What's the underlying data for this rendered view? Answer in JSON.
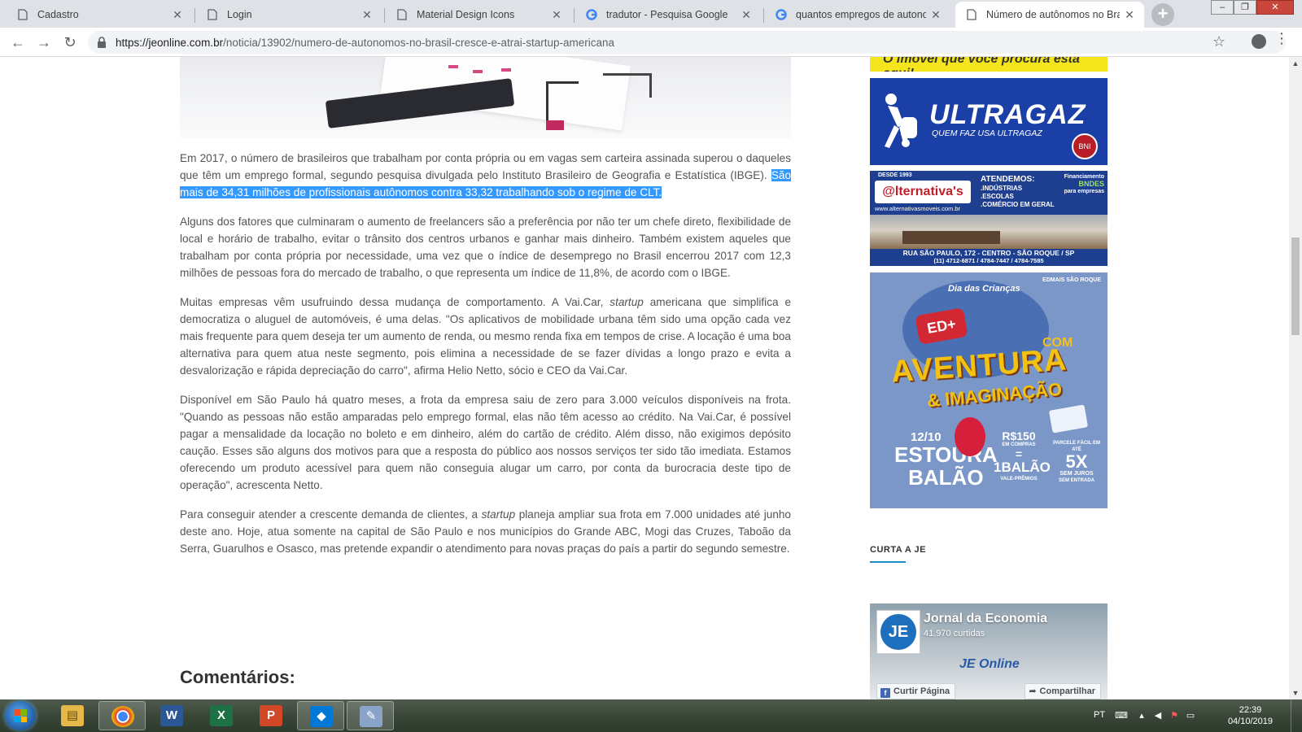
{
  "browser": {
    "tabs": [
      {
        "title": "Cadastro",
        "icon": "page-icon",
        "active": false
      },
      {
        "title": "Login",
        "icon": "page-icon",
        "active": false
      },
      {
        "title": "Material Design Icons",
        "icon": "page-icon",
        "active": false
      },
      {
        "title": "tradutor - Pesquisa Google",
        "icon": "google-icon",
        "active": false
      },
      {
        "title": "quantos empregos de autonom",
        "icon": "google-icon",
        "active": false
      },
      {
        "title": "Número de autônomos no Bras",
        "icon": "page-icon",
        "active": true
      }
    ],
    "close_glyph": "✕",
    "url_host": "https://jeonline.com.br",
    "url_path": "/noticia/13902/numero-de-autonomos-no-brasil-cresce-e-atrai-startup-americana"
  },
  "article": {
    "p1_before": "Em 2017, o número de brasileiros que trabalham por conta própria ou em vagas sem carteira assinada superou o daqueles que têm um emprego formal, segundo pesquisa divulgada pelo Instituto Brasileiro de Geografia e Estatística (IBGE). ",
    "p1_highlight": "São mais de 34,31 milhões de profissionais autônomos contra 33,32 trabalhando sob o regime de CLT.",
    "p2": "Alguns dos fatores que culminaram o aumento de freelancers são a preferência por não ter um chefe direto, flexibilidade de local e horário de trabalho, evitar o trânsito dos centros urbanos e ganhar mais dinheiro. Também existem aqueles que trabalham por conta própria por necessidade, uma vez que o índice de desemprego no Brasil encerrou 2017 com 12,3 milhões de pessoas fora do mercado de trabalho, o que representa um índice de 11,8%, de acordo com o IBGE.",
    "p3_a": "Muitas empresas vêm usufruindo dessa mudança de comportamento. A Vai.Car, ",
    "p3_em": "startup",
    "p3_b": " americana que simplifica e democratiza o aluguel de automóveis, é uma delas. \"Os aplicativos de mobilidade urbana têm sido uma opção cada vez mais frequente para quem deseja ter um aumento de renda, ou mesmo renda fixa em tempos de crise. A locação é uma boa alternativa para quem atua neste segmento, pois elimina a necessidade de se fazer dívidas a longo prazo e evita a desvalorização e rápida depreciação do carro\", afirma Helio Netto, sócio e CEO da Vai.Car.",
    "p4": "Disponível em São Paulo há quatro meses, a frota da empresa saiu de zero para 3.000 veículos disponíveis na frota. \"Quando as pessoas não estão amparadas pelo emprego formal, elas não têm acesso ao crédito. Na Vai.Car, é possível pagar a mensalidade da locação no boleto e em dinheiro, além do cartão de crédito. Além disso, não exigimos depósito caução. Esses são alguns dos motivos para que a resposta do público aos nossos serviços ter sido tão imediata. Estamos oferecendo um produto acessível para quem não conseguia alugar um carro, por conta da burocracia deste tipo de operação\", acrescenta Netto.",
    "p5_a": "Para conseguir atender a crescente demanda de clientes, a ",
    "p5_em": "startup",
    "p5_b": " planeja ampliar sua frota em 7.000 unidades até junho deste ano. Hoje, atua somente na capital de São Paulo e nos municípios do Grande ABC, Mogi das Cruzes, Taboão da Serra, Guarulhos e Osasco, mas pretende expandir o atendimento para novas praças do país a partir do segundo semestre.",
    "comments_title": "Comentários:"
  },
  "sidebar": {
    "ad_yellow_text": "O imóvel que você procura está aqui!",
    "ultragaz": {
      "logo": "ULTRAGAZ",
      "tagline": "QUEM FAZ USA ULTRAGAZ",
      "badge": "BNI"
    },
    "alternativas": {
      "since": "DESDE 1993",
      "brand": "@lternativa's",
      "site": "www.alternativasmoveis.com.br",
      "atend_title": "ATENDEMOS:",
      "atend_1": ".INDÚSTRIAS",
      "atend_2": ".ESCOLAS",
      "atend_3": ".COMÉRCIO EM GERAL",
      "fin_1": "Financiamento",
      "fin_2": "BNDES",
      "fin_3": "para empresas",
      "address": "RUA SÃO PAULO, 172 - CENTRO - SÃO ROQUE / SP",
      "phones": "(11) 4712-6871 / 4784-7447 / 4784-7585"
    },
    "edmais": {
      "dia": "Dia das Crianças",
      "brand": "EDMAIS SÃO ROQUE",
      "rocket": "ED+",
      "com": "COM",
      "aventura": "AVENTURA",
      "imaginacao": "& IMAGINAÇÃO",
      "date": "12/10",
      "estoura_1": "ESTOURA",
      "estoura_2": "BALÃO",
      "price": "R$150",
      "price_sub": "EM COMPRAS",
      "eq": "=",
      "balao": "1BALÃO",
      "vale": "VALE-PRÊMIOS",
      "parc_1": "PARCELE FÁCIL EM ATÉ",
      "parc_five": "5X",
      "parc_2": "SEM JUROS",
      "parc_3": "SEM ENTRADA"
    },
    "curta_label": "CURTA A JE",
    "facebook": {
      "logo": "JE",
      "name": "Jornal da Economia",
      "likes": "41.970 curtidas",
      "watermark": "JE Online",
      "like_btn": "Curtir Página",
      "share_btn": "Compartilhar"
    }
  },
  "taskbar": {
    "apps": [
      {
        "name": "file-explorer",
        "glyph": "▤",
        "color": "#e6b84a"
      },
      {
        "name": "chrome",
        "glyph": "◉",
        "color": "#2f9d3c"
      },
      {
        "name": "word",
        "glyph": "W",
        "color": "#2b5797"
      },
      {
        "name": "excel",
        "glyph": "X",
        "color": "#1e7145"
      },
      {
        "name": "powerpoint",
        "glyph": "P",
        "color": "#d24726"
      },
      {
        "name": "vscode",
        "glyph": "◆",
        "color": "#0078d7"
      },
      {
        "name": "paint",
        "glyph": "✎",
        "color": "#8aa4c8"
      }
    ],
    "lang": "PT",
    "time": "22:39",
    "date": "04/10/2019"
  }
}
